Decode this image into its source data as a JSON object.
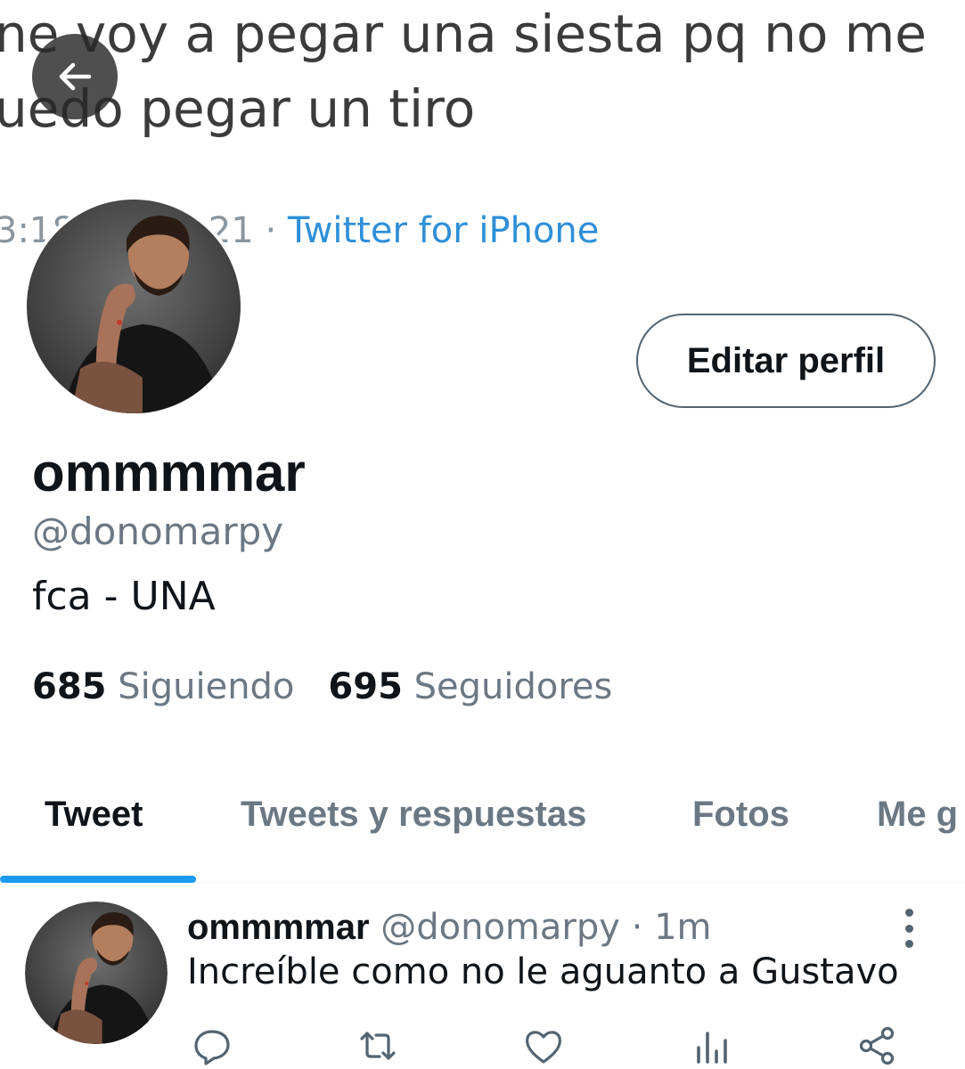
{
  "background_tweet": {
    "line1": "ne voy a pegar una siesta pq no me",
    "line2": "uedo pegar un tiro",
    "time_fragment": "3:18",
    "date_fragment": "21 · ",
    "source": "Twitter for iPhone"
  },
  "profile": {
    "display_name": "ommmmar",
    "handle": "@donomarpy",
    "bio": "fca - UNA",
    "edit_button_label": "Editar perfil",
    "following_count": "685",
    "following_label": "Siguiendo",
    "followers_count": "695",
    "followers_label": "Seguidores"
  },
  "tabs": [
    {
      "label": "Tweet",
      "active": true
    },
    {
      "label": "Tweets y respuestas",
      "active": false
    },
    {
      "label": "Fotos",
      "active": false
    },
    {
      "label": "Me g",
      "active": false
    }
  ],
  "tweet": {
    "name": "ommmmar",
    "handle": "@donomarpy",
    "separator": " · ",
    "time": "1m",
    "text": "Increíble como no le aguanto a Gustavo"
  },
  "icons": {
    "back": "arrow-left-icon",
    "more": "more-vertical-icon",
    "reply": "reply-icon",
    "retweet": "retweet-icon",
    "like": "heart-icon",
    "analytics": "analytics-icon",
    "share": "share-icon"
  },
  "colors": {
    "accent": "#1d9bf0",
    "text_primary": "#0f1419",
    "text_secondary": "#6b7884"
  }
}
